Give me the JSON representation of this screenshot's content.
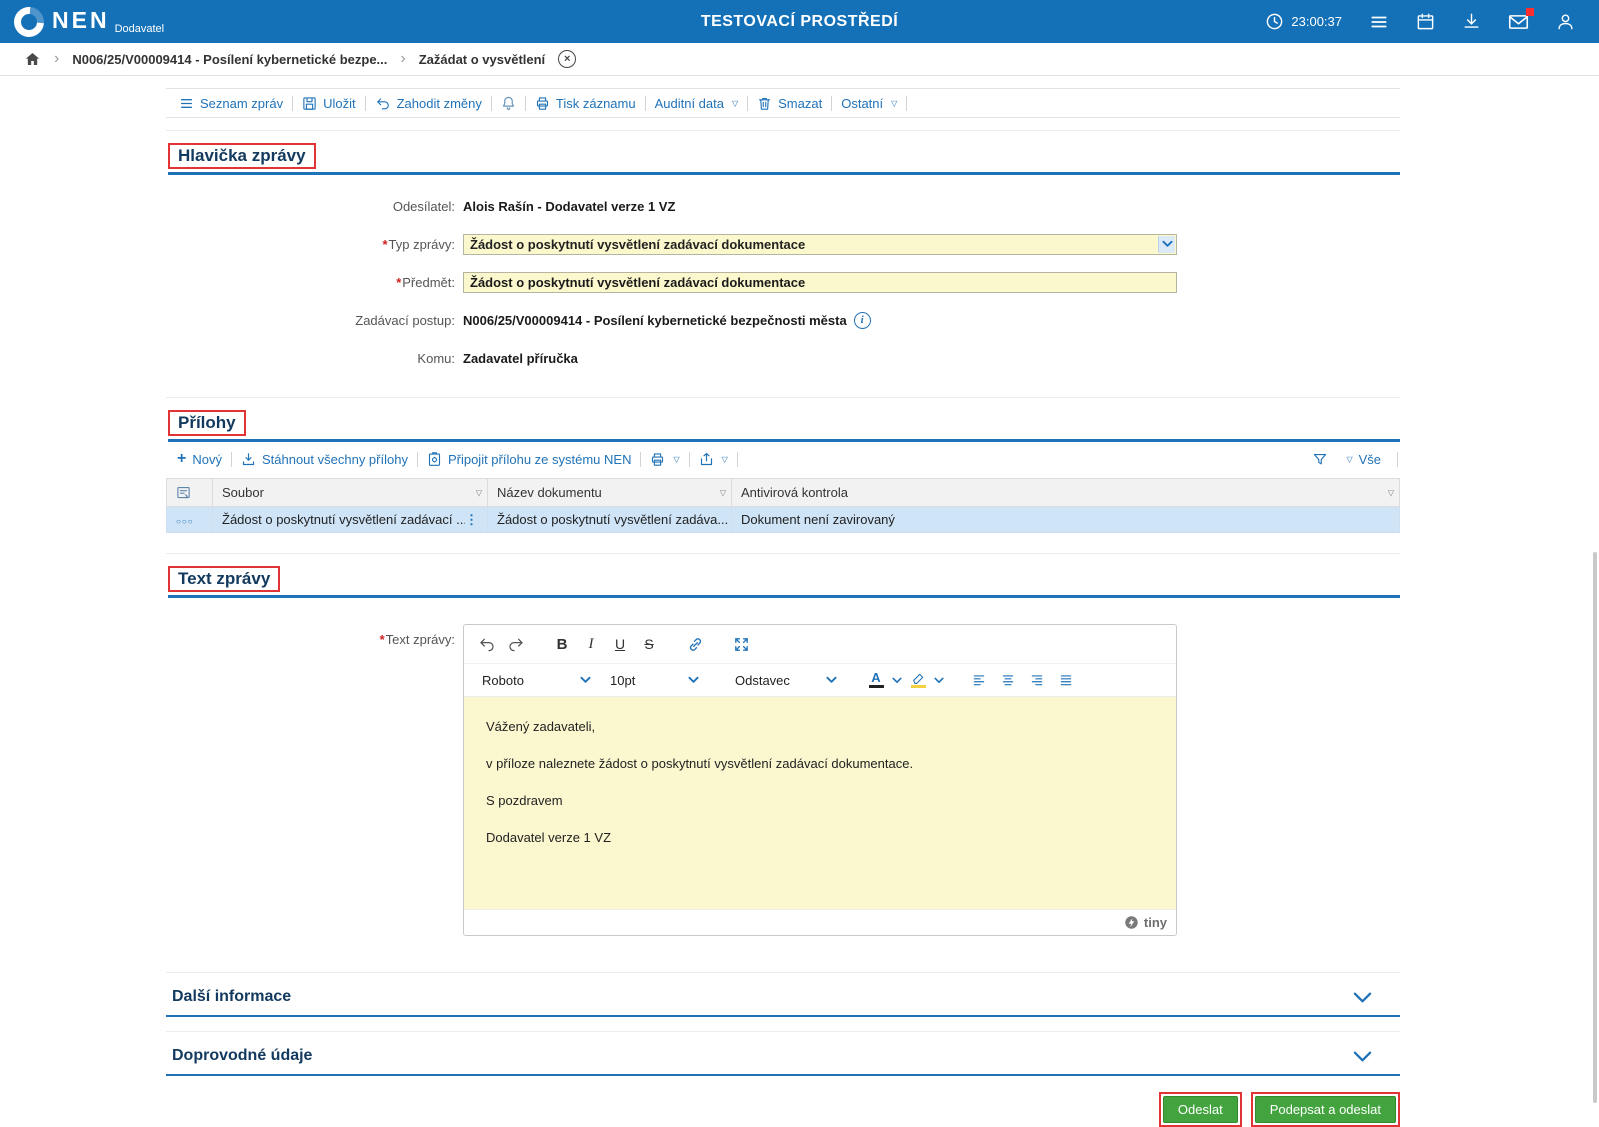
{
  "colors": {
    "topbar_blue": "#1471b8",
    "accent_blue": "#2173b8",
    "input_yellow": "#fcf8cd",
    "editor_yellow": "#fbf7cf",
    "selected_row_blue": "#cfe4f7",
    "green_button": "#43a43f",
    "annotation_red": "#e23434",
    "section_navy": "#12395e"
  },
  "icons": {
    "chevron_right": "›",
    "close": "×",
    "dropdown_small": "▽",
    "plus": "+",
    "row_actions": "○○○",
    "drag_dots": "⋮",
    "required": "*"
  },
  "topbar": {
    "brand": "NEN",
    "brand_sub": "Dodavatel",
    "title": "TESTOVACÍ PROSTŘEDÍ",
    "time": "23:00:37"
  },
  "breadcrumb": {
    "procedure": "N006/25/V00009414 - Posílení kybernetické bezpe...",
    "page": "Zažádat o vysvětlení"
  },
  "toolbar": {
    "seznam_zprav": "Seznam zpráv",
    "ulozit": "Uložit",
    "zahodit_zmeny": "Zahodit změny",
    "tisk_zaznamu": "Tisk záznamu",
    "auditni_data": "Auditní data",
    "smazat": "Smazat",
    "ostatni": "Ostatní"
  },
  "hlavicka": {
    "title": "Hlavička zprávy",
    "odesilatel_label": "Odesílatel:",
    "odesilatel_value": "Alois Rašín - Dodavatel verze 1 VZ",
    "typ_label": "Typ zprávy:",
    "typ_value": "Žádost o poskytnutí vysvětlení zadávací dokumentace",
    "predmet_label": "Předmět:",
    "predmet_value": "Žádost o poskytnutí vysvětlení zadávací dokumentace",
    "postup_label": "Zadávací postup:",
    "postup_value": "N006/25/V00009414 - Posílení kybernetické bezpečnosti města",
    "komu_label": "Komu:",
    "komu_value": "Zadavatel příručka"
  },
  "prilohy": {
    "title": "Přílohy",
    "novy": "Nový",
    "stahnout": "Stáhnout všechny přílohy",
    "pripojit": "Připojit přílohu ze systému NEN",
    "vse": "Vše",
    "columns": {
      "soubor": "Soubor",
      "nazev": "Název dokumentu",
      "antivir": "Antivirová kontrola"
    },
    "rows": [
      {
        "soubor": "Žádost o poskytnutí vysvětlení zadávací ...",
        "nazev": "Žádost o poskytnutí vysvětlení zadáva...",
        "antivir": "Dokument není zavirovaný"
      }
    ]
  },
  "text_zpravy": {
    "title": "Text zprávy",
    "label": "Text zprávy:",
    "font": "Roboto",
    "size": "10pt",
    "format": "Odstavec",
    "bold": "B",
    "italic": "I",
    "underline": "U",
    "strike": "S",
    "color_letter": "A",
    "p1": "Vážený zadavateli,",
    "p2": "v příloze naleznete žádost o poskytnutí vysvětlení zadávací dokumentace.",
    "p3": "S pozdravem",
    "p4": "Dodavatel verze 1 VZ",
    "tiny": "tiny"
  },
  "more_sections": {
    "dalsi": "Další informace",
    "doprovodne": "Doprovodné údaje"
  },
  "footer": {
    "odeslat": "Odeslat",
    "podepsat": "Podepsat a odeslat"
  }
}
